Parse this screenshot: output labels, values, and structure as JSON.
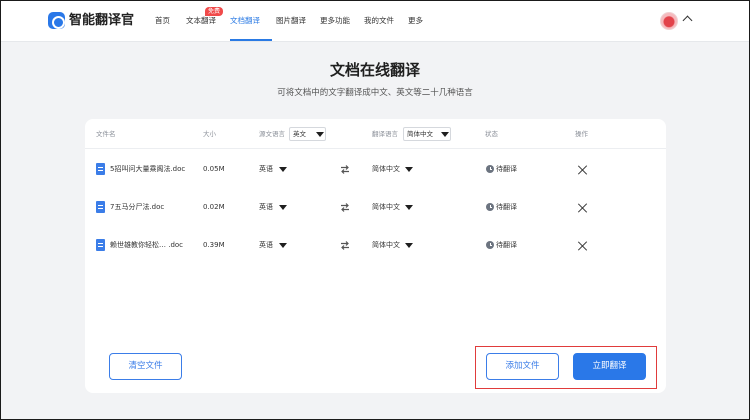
{
  "brand": {
    "name": "智能翻译官"
  },
  "nav": {
    "items": [
      {
        "label": "首页"
      },
      {
        "label": "文本翻译",
        "badge": "免费"
      },
      {
        "label": "文档翻译",
        "active": true
      },
      {
        "label": "图片翻译"
      },
      {
        "label": "更多功能"
      },
      {
        "label": "我的文件"
      },
      {
        "label": "更多"
      }
    ]
  },
  "page": {
    "title": "文档在线翻译",
    "subtitle": "可将文档中的文字翻译成中文、英文等二十几种语言"
  },
  "table": {
    "headers": {
      "filename": "文件名",
      "size": "大小",
      "source_lang": "源文语言",
      "source_lang_value": "英文",
      "target_lang": "翻译语言",
      "target_lang_value": "简体中文",
      "status": "状态",
      "action": "操作"
    },
    "rows": [
      {
        "filename": "5招叫问大量乘阁法.doc",
        "size": "0.05M",
        "source": "英语",
        "target": "简体中文",
        "status": "待翻译"
      },
      {
        "filename": "7五马分尸法.doc",
        "size": "0.02M",
        "source": "英语",
        "target": "简体中文",
        "status": "待翻译"
      },
      {
        "filename": "赖世雄教你轻松…   .doc",
        "size": "0.39M",
        "source": "英语",
        "target": "简体中文",
        "status": "待翻译"
      }
    ]
  },
  "actions": {
    "clear": "清空文件",
    "add": "添加文件",
    "translate": "立即翻译"
  },
  "colors": {
    "accent": "#2a78e8",
    "highlight": "#e03b3b",
    "badge": "#f04a4a"
  }
}
